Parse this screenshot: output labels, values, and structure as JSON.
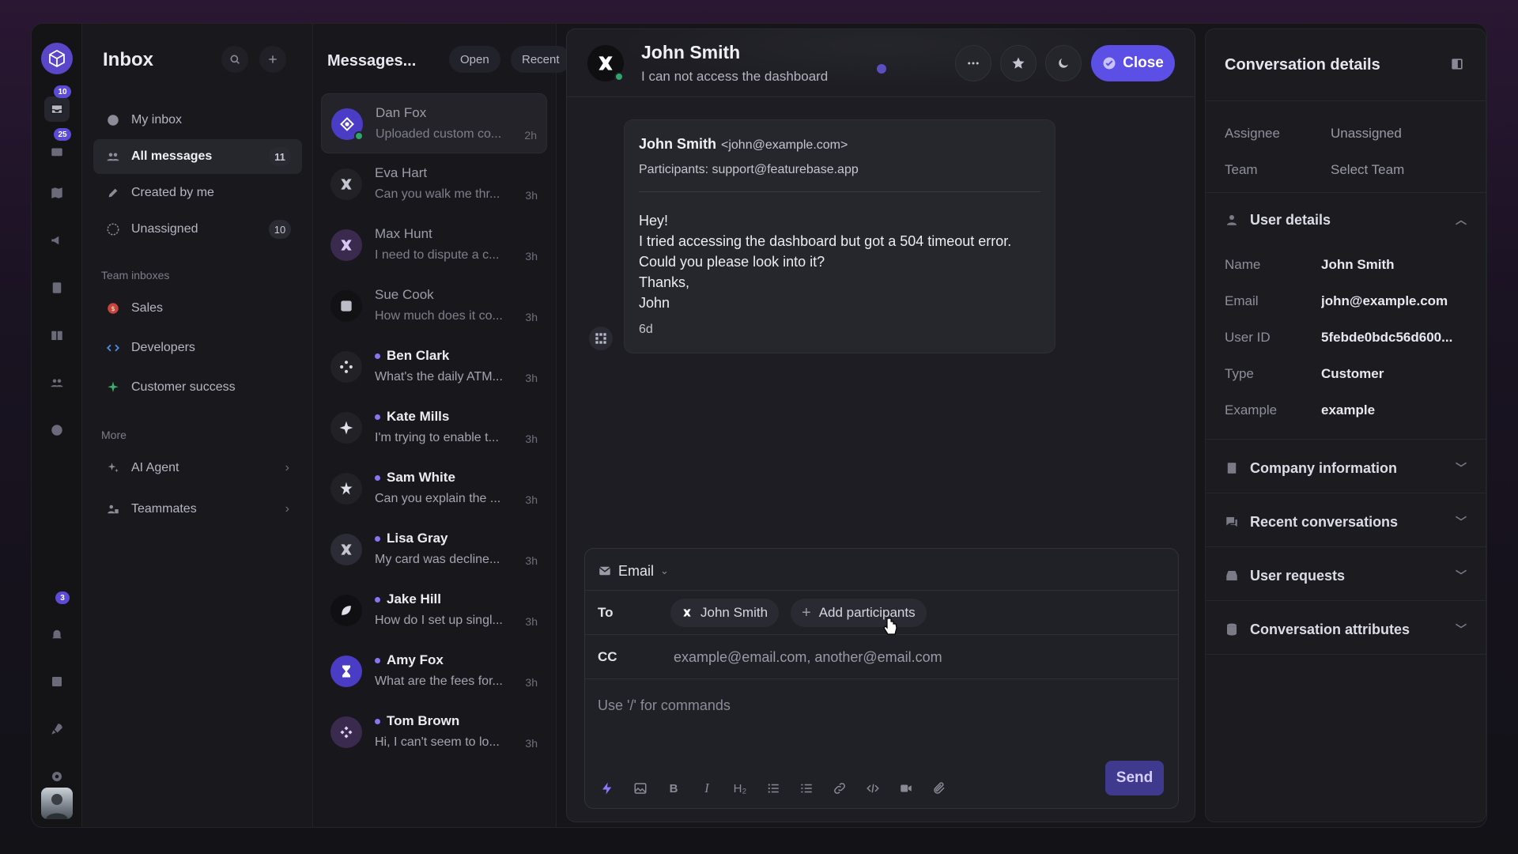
{
  "rail": {
    "inbox_badge": "10",
    "tickets_badge": "25",
    "notifications_badge": "3"
  },
  "nav": {
    "title": "Inbox",
    "items": [
      {
        "label": "My inbox",
        "count": ""
      },
      {
        "label": "All messages",
        "count": "11"
      },
      {
        "label": "Created by me",
        "count": ""
      },
      {
        "label": "Unassigned",
        "count": "10"
      }
    ],
    "team_label": "Team inboxes",
    "teams": [
      "Sales",
      "Developers",
      "Customer success"
    ],
    "more_label": "More",
    "more": [
      "AI Agent",
      "Teammates"
    ]
  },
  "messages": {
    "title": "Messages...",
    "filter_status": "Open",
    "filter_sort": "Recent",
    "list": [
      {
        "name": "Dan Fox",
        "preview": "Uploaded custom co...",
        "time": "2h"
      },
      {
        "name": "Eva Hart",
        "preview": "Can you walk me thr...",
        "time": "3h"
      },
      {
        "name": "Max Hunt",
        "preview": "I need to dispute a c...",
        "time": "3h"
      },
      {
        "name": "Sue Cook",
        "preview": "How much does it co...",
        "time": "3h"
      },
      {
        "name": "Ben Clark",
        "preview": "What's the daily ATM...",
        "time": "3h"
      },
      {
        "name": "Kate Mills",
        "preview": "I'm trying to enable t...",
        "time": "3h"
      },
      {
        "name": "Sam White",
        "preview": "Can you explain the ...",
        "time": "3h"
      },
      {
        "name": "Lisa Gray",
        "preview": "My card was decline...",
        "time": "3h"
      },
      {
        "name": "Jake Hill",
        "preview": "How do I set up singl...",
        "time": "3h"
      },
      {
        "name": "Amy Fox",
        "preview": "What are the fees for...",
        "time": "3h"
      },
      {
        "name": "Tom Brown",
        "preview": "Hi, I can't seem to lo...",
        "time": "3h"
      }
    ]
  },
  "conversation": {
    "name": "John Smith",
    "subject": "I can not access the dashboard",
    "close_label": "Close",
    "message": {
      "from_name": "John Smith",
      "from_email": "<john@example.com>",
      "participants": "Participants: support@featurebase.app",
      "body": [
        "Hey!",
        "I tried accessing the dashboard but got a 504 timeout error.",
        "Could you please look into it?",
        "Thanks,",
        "John"
      ],
      "ago": "6d"
    }
  },
  "composer": {
    "channel": "Email",
    "to_label": "To",
    "to_recipient": "John Smith",
    "add_participants": "Add participants",
    "cc_label": "CC",
    "cc_placeholder": "example@email.com, another@email.com",
    "commands_placeholder": "Use '/' for commands",
    "send_label": "Send",
    "toolbar_h2": "H₂"
  },
  "details": {
    "title": "Conversation details",
    "assignee_label": "Assignee",
    "assignee_value": "Unassigned",
    "team_label": "Team",
    "team_value": "Select Team",
    "user_details": "User details",
    "fields": [
      {
        "label": "Name",
        "value": "John Smith"
      },
      {
        "label": "Email",
        "value": "john@example.com"
      },
      {
        "label": "User ID",
        "value": "5febde0bdc56d600..."
      },
      {
        "label": "Type",
        "value": "Customer"
      },
      {
        "label": "Example",
        "value": "example"
      }
    ],
    "sections": [
      "Company information",
      "Recent conversations",
      "User requests",
      "Conversation attributes"
    ]
  }
}
